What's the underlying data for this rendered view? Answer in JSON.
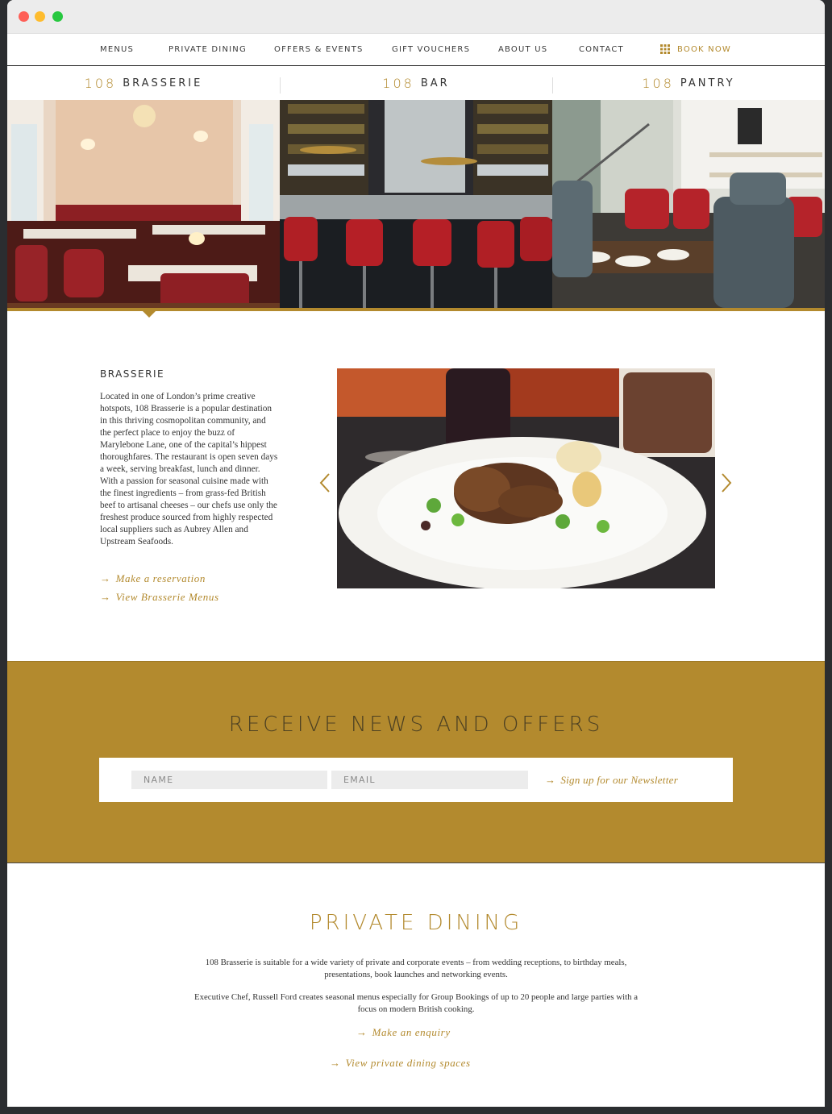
{
  "nav": {
    "items": [
      "MENUS",
      "PRIVATE DINING",
      "OFFERS & EVENTS",
      "GIFT VOUCHERS",
      "ABOUT US",
      "CONTACT"
    ],
    "book_label": "BOOK NOW",
    "book_icon": "calendar-grid-icon"
  },
  "venues": [
    {
      "number": "108",
      "name": "BRASSERIE"
    },
    {
      "number": "108",
      "name": "BAR"
    },
    {
      "number": "108",
      "name": "PANTRY"
    }
  ],
  "brasserie": {
    "heading": "BRASSERIE",
    "body": "Located in one of London’s prime creative hotspots, 108 Brasserie is a popular destination in this thriving cosmopolitan community, and the perfect place to enjoy the buzz of Marylebone Lane, one of the capital’s hippest thoroughfares. The restaurant is open seven days a week, serving breakfast, lunch and dinner. With a passion for seasonal cuisine made with the finest ingredients – from grass-fed British beef to artisanal cheeses – our chefs use only the freshest produce sourced from highly respected local suppliers such as Aubrey Allen and Upstream Seafoods.",
    "link_reservation": "Make a reservation",
    "link_menus": "View Brasserie Menus"
  },
  "newsletter": {
    "title": "RECEIVE NEWS AND OFFERS",
    "name_placeholder": "NAME",
    "email_placeholder": "EMAIL",
    "signup_label": "Sign up for our Newsletter"
  },
  "private_dining": {
    "title": "PRIVATE DINING",
    "para1": "108 Brasserie is suitable for a wide variety of private and corporate events – from wedding receptions, to birthday meals, presentations, book launches and networking events.",
    "para2": "Executive Chef, Russell Ford creates seasonal menus especially for Group Bookings of up to 20 people and large parties with a focus on modern British cooking.",
    "link_enquiry": "Make an enquiry",
    "link_spaces": "View private dining spaces"
  },
  "colors": {
    "accent": "#b38a2e",
    "text": "#333333"
  }
}
